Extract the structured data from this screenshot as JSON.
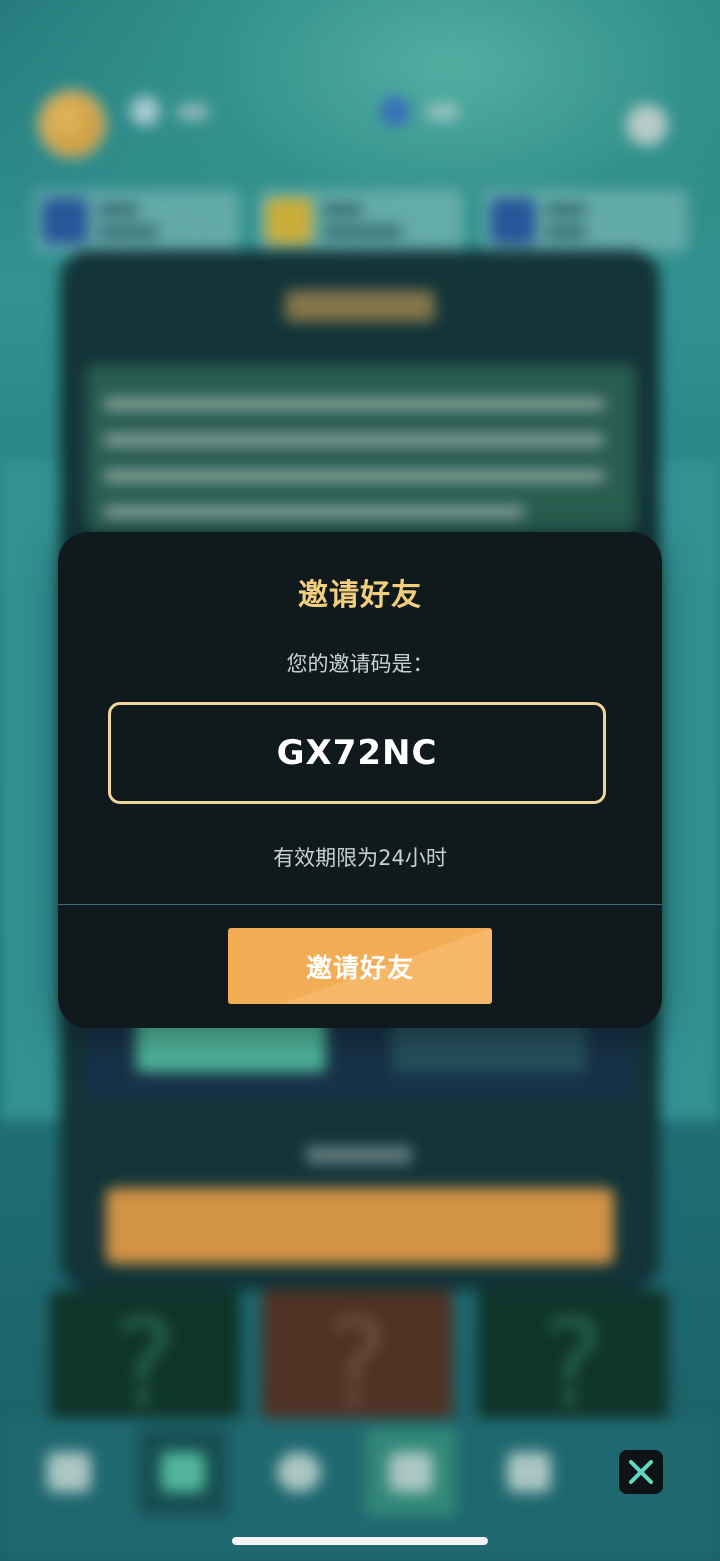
{
  "modal": {
    "title": "邀请好友",
    "subtitle": "您的邀请码是：",
    "invite_code": "GX72NC",
    "validity_note": "有效期限为24小时",
    "invite_button_label": "邀请好友"
  },
  "background": {
    "mystery_cards": [
      "?",
      "?",
      "?"
    ]
  },
  "colors": {
    "title_gold": "#f2cf7d",
    "code_border": "#f0d59a",
    "button_orange": "#f3ad55",
    "modal_bg": "#101a1c"
  },
  "icons": {
    "close": "close-icon"
  }
}
